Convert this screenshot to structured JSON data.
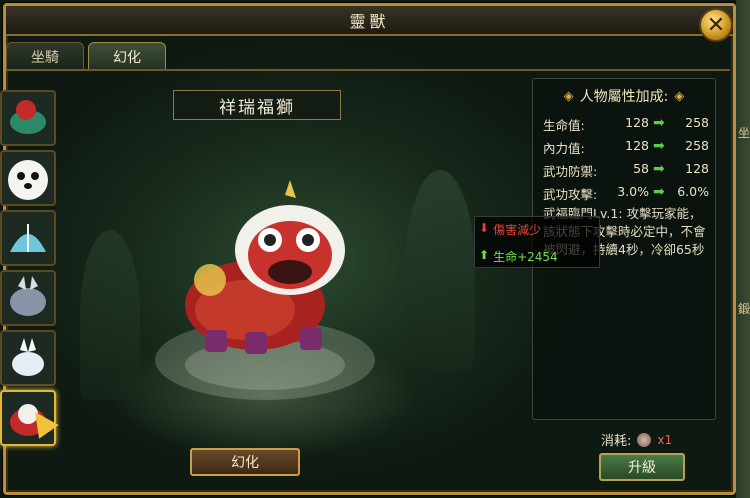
{
  "window": {
    "title": "靈獸",
    "close_icon": "close-icon"
  },
  "tabs": [
    {
      "label": "坐騎",
      "active": false
    },
    {
      "label": "幻化",
      "active": true
    }
  ],
  "pet_list": [
    {
      "name": "red-dragon-pet",
      "selected": false
    },
    {
      "name": "panda-pet",
      "selected": false
    },
    {
      "name": "blue-fan-pet",
      "selected": false
    },
    {
      "name": "silver-beast-pet",
      "selected": false
    },
    {
      "name": "white-wolf-pet",
      "selected": false
    },
    {
      "name": "lion-pet",
      "selected": true
    }
  ],
  "pet": {
    "name": "祥瑞福獅"
  },
  "transform_button": "幻化",
  "attributes": {
    "header": "人物屬性加成:",
    "rows": [
      {
        "label": "生命值:",
        "from": "128",
        "to": "258"
      },
      {
        "label": "內力值:",
        "from": "128",
        "to": "258"
      },
      {
        "label": "武功防禦:",
        "from": "58",
        "to": "128"
      },
      {
        "label": "武功攻擊:",
        "from": "3.0%",
        "to": "6.0%"
      }
    ],
    "skill_text": "武福臨門Lv.1: 攻擊玩家能，該狀態下攻擊時必定中，不會被閃避，持續4秒，冷卻65秒"
  },
  "tooltip": {
    "line1_icon": "down-arrow-icon",
    "line1": "傷害減少",
    "line2_icon": "up-arrow-icon",
    "line2": "生命+2454"
  },
  "consume": {
    "label": "消耗:",
    "qty": "x1"
  },
  "upgrade_button": "升級",
  "right_edge": {
    "char1": "坐",
    "char2": "鍛"
  }
}
